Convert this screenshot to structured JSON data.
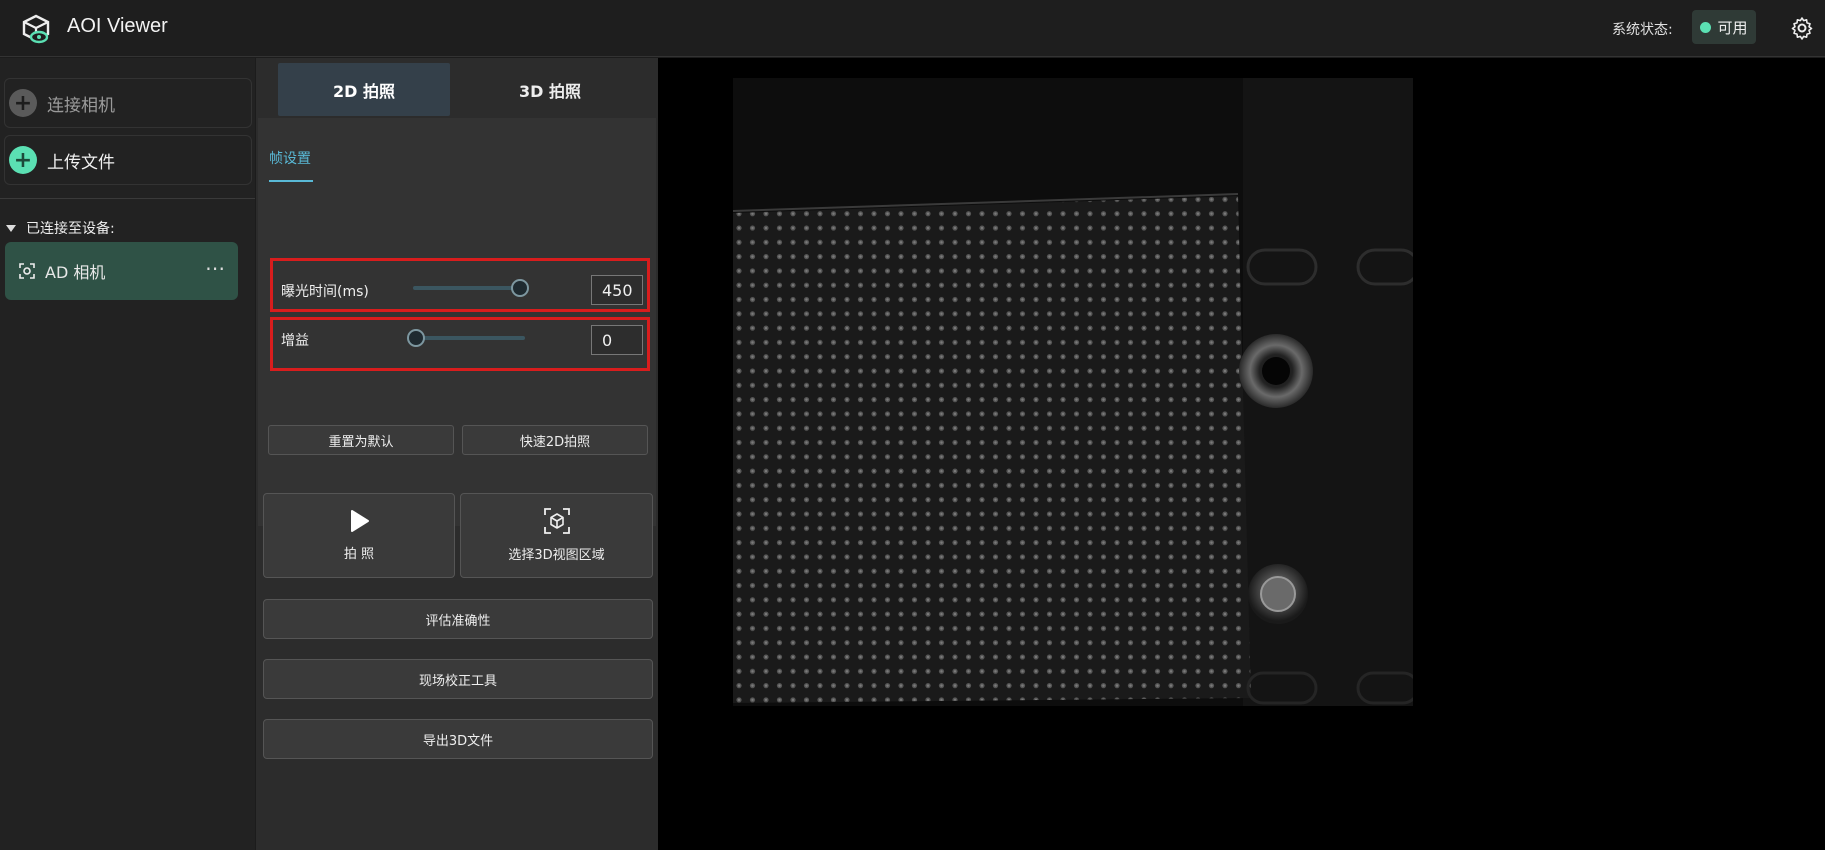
{
  "header": {
    "app_title": "AOI Viewer",
    "status_label": "系统状态:",
    "status_value": "可用",
    "status_color": "#5be0b3"
  },
  "sidebar": {
    "connect_camera": "连接相机",
    "upload_file": "上传文件",
    "connected_header": "已连接至设备:",
    "device_name": "AD 相机",
    "more_icon": "⋯"
  },
  "panel": {
    "tabs": [
      {
        "label": "2D 拍照",
        "active": true
      },
      {
        "label": "3D 拍照",
        "active": false
      }
    ],
    "subtab": "帧设置",
    "exposure": {
      "label": "曝光时间(ms)",
      "value": "450",
      "level": 1.0
    },
    "gain": {
      "label": "增益",
      "value": "0",
      "level": 0.0
    },
    "reset_label": "重置为默认",
    "quick_label": "快速2D拍照",
    "capture_label": "拍 照",
    "select_3d_label": "选择3D视图区域",
    "evaluate_label": "评估准确性",
    "calibrate_label": "现场校正工具",
    "export_label": "导出3D文件"
  }
}
